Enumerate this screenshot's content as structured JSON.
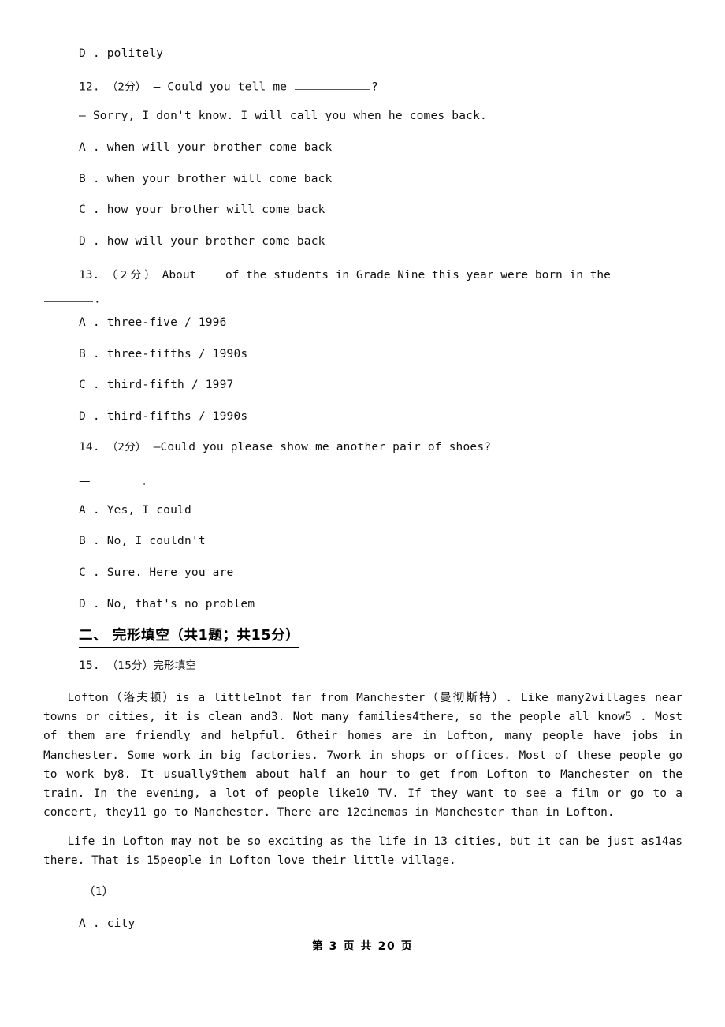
{
  "document": {
    "footer": "第 3 页 共 20 页",
    "page_number": "3",
    "total_pages": "20"
  },
  "questions": [
    {
      "id": "q11-option-d",
      "label": "D .",
      "text": "politely"
    },
    {
      "id": "q12",
      "number": "12.",
      "marks": "（2分）",
      "stem_prefix": "— Could you tell me",
      "stem_suffix": "?",
      "reply": "— Sorry, I don't know. I will call you when he comes back.",
      "options": [
        {
          "label": "A .",
          "text": "when will your brother come back"
        },
        {
          "label": "B .",
          "text": "when your brother will come back"
        },
        {
          "label": "C .",
          "text": "how your brother will come back"
        },
        {
          "label": "D .",
          "text": "how will your brother come back"
        }
      ]
    },
    {
      "id": "q13",
      "number": "13.",
      "marks": "（ 2 分 ）",
      "stem_part1": "About",
      "stem_part2": "of the students in Grade Nine this year were born in the",
      "stem_part3": ".",
      "options": [
        {
          "label": "A .",
          "text": "three-five / 1996"
        },
        {
          "label": "B .",
          "text": "three-fifths / 1990s"
        },
        {
          "label": "C .",
          "text": "third-fifth / 1997"
        },
        {
          "label": "D .",
          "text": "third-fifths / 1990s"
        }
      ]
    },
    {
      "id": "q14",
      "number": "14.",
      "marks": "（2分）",
      "stem": "—Could you please show me another pair of shoes?",
      "reply_prefix": "—",
      "reply_suffix": ".",
      "options": [
        {
          "label": "A .",
          "text": "Yes, I could"
        },
        {
          "label": "B .",
          "text": "No, I couldn't"
        },
        {
          "label": "C .",
          "text": "Sure. Here you are"
        },
        {
          "label": "D .",
          "text": "No, that's no problem"
        }
      ]
    }
  ],
  "section": {
    "heading": "二、 完形填空（共1题；共15分）",
    "question_number": "15.",
    "question_marks": "（15分）",
    "question_title": "完形填空",
    "passage": {
      "paragraph1": "Lofton（洛夫顿）is a little1not far from Manchester（曼彻斯特）. Like many2villages near towns or cities, it is clean and3. Not many families4there, so the people all know5 . Most of them are friendly and helpful. 6their homes are in Lofton, many people have jobs in Manchester. Some work in big factories. 7work in shops or offices. Most of these people go to work by8. It usually9them about half an hour to get from Lofton to Manchester on the train. In the evening, a lot of people like10  TV. If they want to see a film or go to a concert, they11  go to Manchester. There are 12cinemas in Manchester than in Lofton.",
      "paragraph2": "Life in Lofton may not be so exciting as the life in 13  cities, but it can be just as14as there. That is 15people in Lofton love their little village."
    },
    "sub_question": {
      "number": "（1）",
      "options": [
        {
          "label": "A .",
          "text": "city"
        }
      ]
    }
  }
}
